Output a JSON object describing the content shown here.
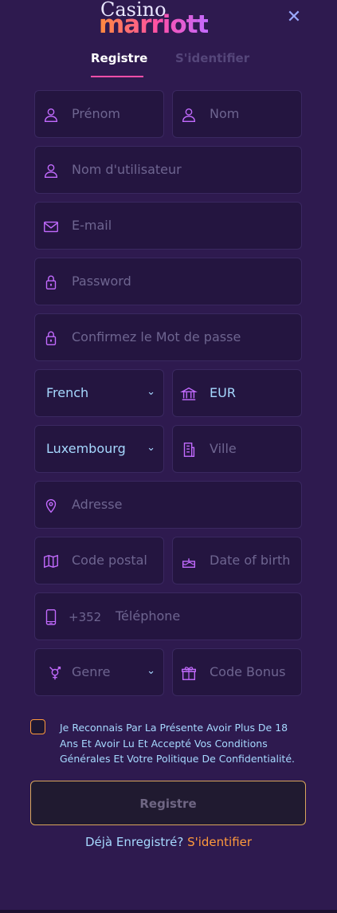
{
  "brand": {
    "line1": "Casino",
    "line2": "marriott"
  },
  "tabs": {
    "register": "Registre",
    "login": "S'identifier"
  },
  "fields": {
    "first_name": "Prénom",
    "last_name": "Nom",
    "username": "Nom d'utilisateur",
    "email": "E-mail",
    "password": "Password",
    "confirm_password": "Confirmez le Mot de passe",
    "language": "French",
    "currency": "EUR",
    "country": "Luxembourg",
    "city": "Ville",
    "address": "Adresse",
    "postal_code": "Code postal",
    "dob": "Date of birth",
    "phone_prefix": "+352",
    "phone": "Téléphone",
    "gender": "Genre",
    "bonus": "Code Bonus"
  },
  "terms": "Je Reconnais Par La Présente Avoir Plus De 18 Ans Et Avoir Lu Et Accepté Vos Conditions Générales Et Votre Politique De Confidentialité.",
  "submit": "Registre",
  "footer": {
    "question": "Déjà Enregistré?",
    "link": "S'identifier"
  },
  "colors": {
    "background": "#2e1a4f",
    "accent": "#ff4fa8",
    "orange": "#ff9a3c",
    "text_light": "#a6d9ff"
  }
}
